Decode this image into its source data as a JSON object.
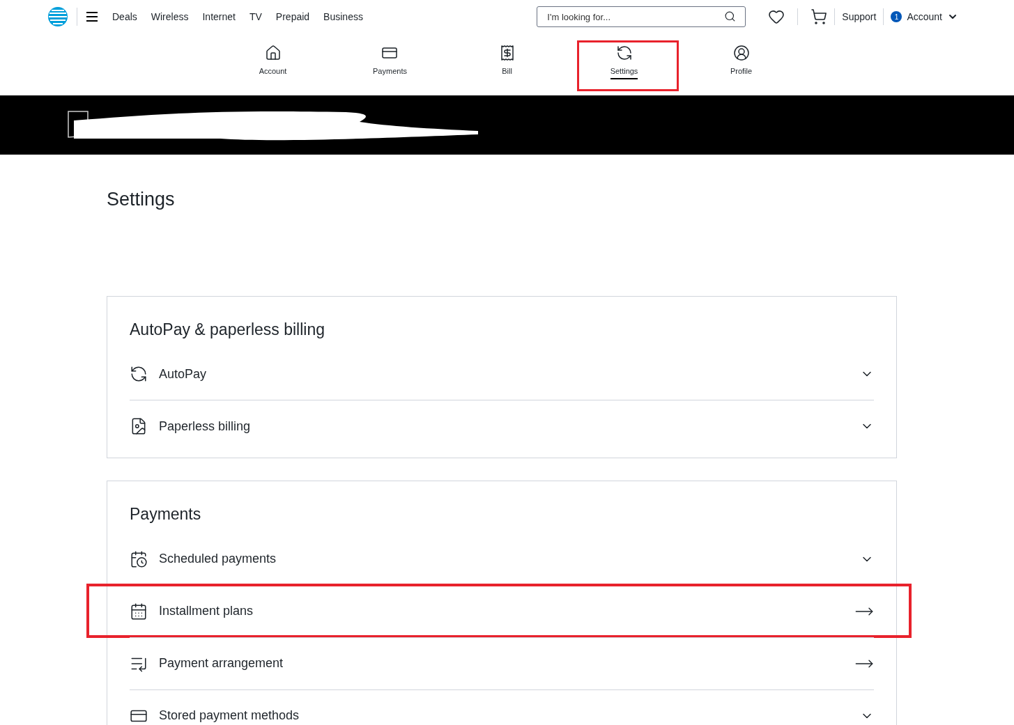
{
  "top_nav": {
    "links": [
      "Deals",
      "Wireless",
      "Internet",
      "TV",
      "Prepaid",
      "Business"
    ],
    "search": {
      "placeholder": "I'm looking for..."
    },
    "support": "Support",
    "account": {
      "badge": "1",
      "label": "Account"
    }
  },
  "sub_nav": [
    {
      "kind": "home",
      "label": "Account",
      "selected": false,
      "highlighted": false
    },
    {
      "kind": "payments",
      "label": "Payments",
      "selected": false,
      "highlighted": false
    },
    {
      "kind": "bill",
      "label": "Bill",
      "selected": false,
      "highlighted": false
    },
    {
      "kind": "settings",
      "label": "Settings",
      "selected": true,
      "highlighted": true
    },
    {
      "kind": "profile",
      "label": "Profile",
      "selected": false,
      "highlighted": false
    }
  ],
  "page_title": "Settings",
  "sections": [
    {
      "title": "AutoPay & paperless billing",
      "items": [
        {
          "label": "AutoPay",
          "kind": "accordion",
          "highlighted": false
        },
        {
          "label": "Paperless billing",
          "kind": "accordion",
          "highlighted": false
        }
      ]
    },
    {
      "title": "Payments",
      "items": [
        {
          "label": "Scheduled payments",
          "kind": "accordion",
          "highlighted": false
        },
        {
          "label": "Installment plans",
          "kind": "link",
          "highlighted": true
        },
        {
          "label": "Payment arrangement",
          "kind": "link",
          "highlighted": false
        },
        {
          "label": "Stored payment methods",
          "kind": "accordion",
          "highlighted": false
        }
      ]
    }
  ]
}
